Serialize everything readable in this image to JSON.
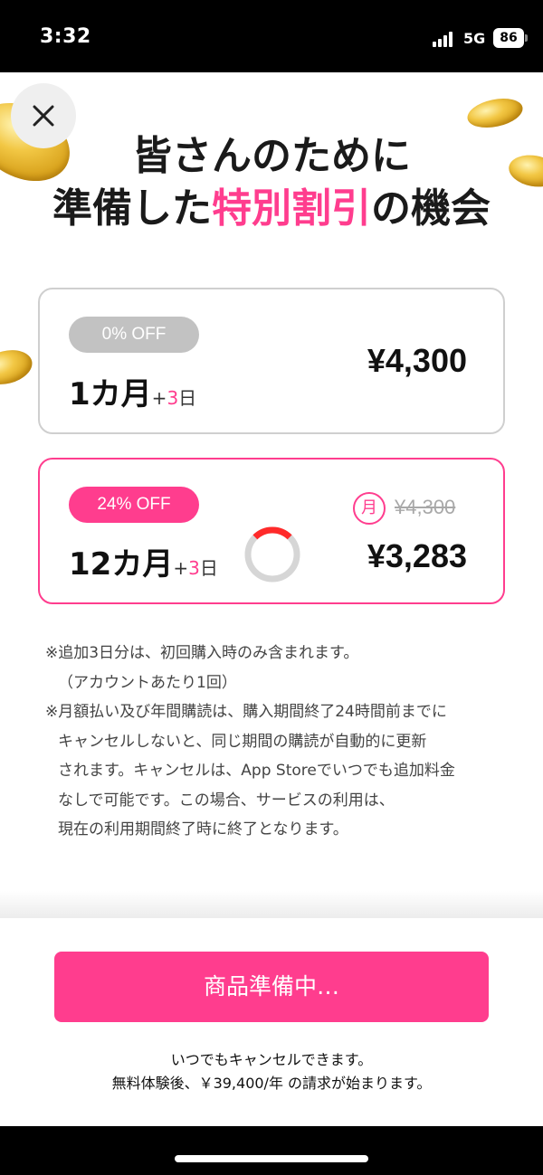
{
  "status_bar": {
    "time": "3:32",
    "network": "5G",
    "battery": "86"
  },
  "close": {
    "icon": "close-icon"
  },
  "headline": {
    "line1": "皆さんのために",
    "line2_prefix": "準備した",
    "line2_highlight": "特別割引",
    "line2_suffix": "の機会"
  },
  "plans": [
    {
      "discount": "0% OFF",
      "duration": "1カ月",
      "plus": "+",
      "bonus": "3",
      "day": "日",
      "price": "¥4,300"
    },
    {
      "discount": "24% OFF",
      "duration": "12カ月",
      "plus": "+",
      "bonus": "3",
      "day": "日",
      "monthly_label": "月",
      "original_price": "¥4,300",
      "price": "¥3,283"
    }
  ],
  "notes": [
    "※追加3日分は、初回購入時のみ含まれます。",
    "（アカウントあたり1回）",
    "※月額払い及び年間購読は、購入期間終了24時間前までに",
    "キャンセルしないと、同じ期間の購読が自動的に更新",
    "されます。キャンセルは、App Storeでいつでも追加料金",
    "なしで可能です。この場合、サービスの利用は、",
    "現在の利用期間終了時に終了となります。"
  ],
  "cta": {
    "label": "商品準備中…"
  },
  "footer": {
    "line1": "いつでもキャンセルできます。",
    "line2": "無料体験後、￥39,400/年 の請求が始まります。"
  },
  "colors": {
    "accent": "#ff3d8e",
    "badge_gray": "#c2c2c2",
    "card_border": "#cfcfcf"
  }
}
